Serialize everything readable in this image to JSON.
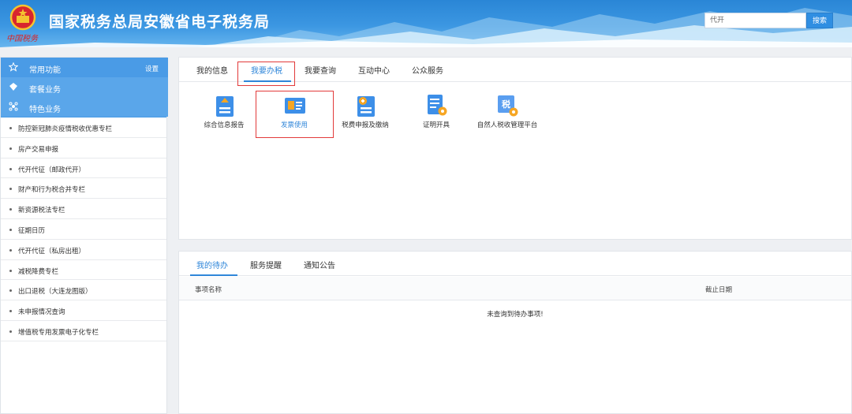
{
  "header": {
    "site_title": "国家税务总局安徽省电子税务局",
    "slogan": "中国税务",
    "search_value": "代开",
    "search_button": "搜索"
  },
  "sidebar": {
    "top": [
      {
        "icon": "star-icon",
        "label": "常用功能",
        "extra": "设置"
      },
      {
        "icon": "gem-icon",
        "label": "套餐业务"
      },
      {
        "icon": "cluster-icon",
        "label": "特色业务"
      }
    ],
    "items": [
      "防控新冠肺炎疫情税收优惠专栏",
      "房产交易申报",
      "代开代征（邮政代开）",
      "财产和行为税合并专栏",
      "新资源税法专栏",
      "征期日历",
      "代开代征（私房出租）",
      "减税降费专栏",
      "出口退税（大连龙图版）",
      "未申报情况查询",
      "增值税专用发票电子化专栏"
    ]
  },
  "main_tabs": [
    "我的信息",
    "我要办税",
    "我要查询",
    "互动中心",
    "公众服务"
  ],
  "services": [
    {
      "icon": "report-icon",
      "label": "综合信息报告"
    },
    {
      "icon": "invoice-icon",
      "label": "发票使用"
    },
    {
      "icon": "tax-declare-icon",
      "label": "税费申报及缴纳"
    },
    {
      "icon": "certificate-icon",
      "label": "证明开具"
    },
    {
      "icon": "personal-tax-icon",
      "label": "自然人税收管理平台"
    }
  ],
  "todo_tabs": [
    "我的待办",
    "服务提醒",
    "通知公告"
  ],
  "todo_table": {
    "col_name": "事项名称",
    "col_deadline": "截止日期",
    "empty": "未查询到待办事项!"
  },
  "colors": {
    "accent": "#2f86d9",
    "highlight": "#e23a3a",
    "sidebar": "#4a9be6"
  }
}
